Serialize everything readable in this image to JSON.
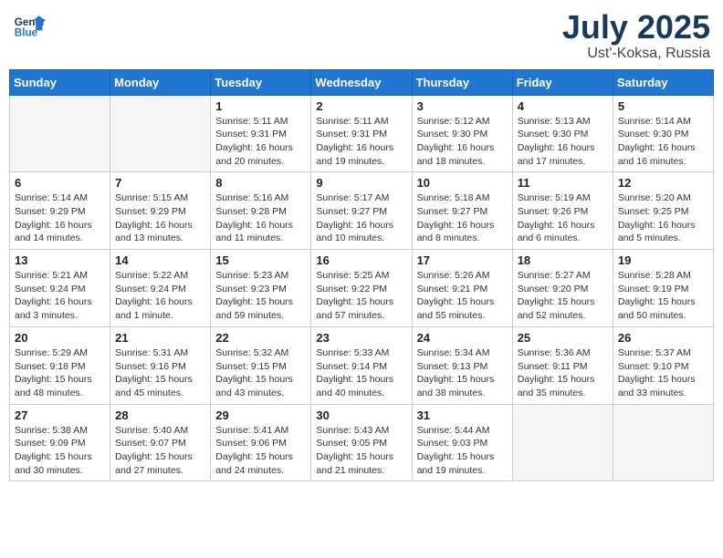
{
  "header": {
    "logo_line1": "General",
    "logo_line2": "Blue",
    "title": "July 2025",
    "subtitle": "Ust'-Koksa, Russia"
  },
  "weekdays": [
    "Sunday",
    "Monday",
    "Tuesday",
    "Wednesday",
    "Thursday",
    "Friday",
    "Saturday"
  ],
  "weeks": [
    [
      {
        "day": "",
        "info": ""
      },
      {
        "day": "",
        "info": ""
      },
      {
        "day": "1",
        "info": "Sunrise: 5:11 AM\nSunset: 9:31 PM\nDaylight: 16 hours\nand 20 minutes."
      },
      {
        "day": "2",
        "info": "Sunrise: 5:11 AM\nSunset: 9:31 PM\nDaylight: 16 hours\nand 19 minutes."
      },
      {
        "day": "3",
        "info": "Sunrise: 5:12 AM\nSunset: 9:30 PM\nDaylight: 16 hours\nand 18 minutes."
      },
      {
        "day": "4",
        "info": "Sunrise: 5:13 AM\nSunset: 9:30 PM\nDaylight: 16 hours\nand 17 minutes."
      },
      {
        "day": "5",
        "info": "Sunrise: 5:14 AM\nSunset: 9:30 PM\nDaylight: 16 hours\nand 16 minutes."
      }
    ],
    [
      {
        "day": "6",
        "info": "Sunrise: 5:14 AM\nSunset: 9:29 PM\nDaylight: 16 hours\nand 14 minutes."
      },
      {
        "day": "7",
        "info": "Sunrise: 5:15 AM\nSunset: 9:29 PM\nDaylight: 16 hours\nand 13 minutes."
      },
      {
        "day": "8",
        "info": "Sunrise: 5:16 AM\nSunset: 9:28 PM\nDaylight: 16 hours\nand 11 minutes."
      },
      {
        "day": "9",
        "info": "Sunrise: 5:17 AM\nSunset: 9:27 PM\nDaylight: 16 hours\nand 10 minutes."
      },
      {
        "day": "10",
        "info": "Sunrise: 5:18 AM\nSunset: 9:27 PM\nDaylight: 16 hours\nand 8 minutes."
      },
      {
        "day": "11",
        "info": "Sunrise: 5:19 AM\nSunset: 9:26 PM\nDaylight: 16 hours\nand 6 minutes."
      },
      {
        "day": "12",
        "info": "Sunrise: 5:20 AM\nSunset: 9:25 PM\nDaylight: 16 hours\nand 5 minutes."
      }
    ],
    [
      {
        "day": "13",
        "info": "Sunrise: 5:21 AM\nSunset: 9:24 PM\nDaylight: 16 hours\nand 3 minutes."
      },
      {
        "day": "14",
        "info": "Sunrise: 5:22 AM\nSunset: 9:24 PM\nDaylight: 16 hours\nand 1 minute."
      },
      {
        "day": "15",
        "info": "Sunrise: 5:23 AM\nSunset: 9:23 PM\nDaylight: 15 hours\nand 59 minutes."
      },
      {
        "day": "16",
        "info": "Sunrise: 5:25 AM\nSunset: 9:22 PM\nDaylight: 15 hours\nand 57 minutes."
      },
      {
        "day": "17",
        "info": "Sunrise: 5:26 AM\nSunset: 9:21 PM\nDaylight: 15 hours\nand 55 minutes."
      },
      {
        "day": "18",
        "info": "Sunrise: 5:27 AM\nSunset: 9:20 PM\nDaylight: 15 hours\nand 52 minutes."
      },
      {
        "day": "19",
        "info": "Sunrise: 5:28 AM\nSunset: 9:19 PM\nDaylight: 15 hours\nand 50 minutes."
      }
    ],
    [
      {
        "day": "20",
        "info": "Sunrise: 5:29 AM\nSunset: 9:18 PM\nDaylight: 15 hours\nand 48 minutes."
      },
      {
        "day": "21",
        "info": "Sunrise: 5:31 AM\nSunset: 9:16 PM\nDaylight: 15 hours\nand 45 minutes."
      },
      {
        "day": "22",
        "info": "Sunrise: 5:32 AM\nSunset: 9:15 PM\nDaylight: 15 hours\nand 43 minutes."
      },
      {
        "day": "23",
        "info": "Sunrise: 5:33 AM\nSunset: 9:14 PM\nDaylight: 15 hours\nand 40 minutes."
      },
      {
        "day": "24",
        "info": "Sunrise: 5:34 AM\nSunset: 9:13 PM\nDaylight: 15 hours\nand 38 minutes."
      },
      {
        "day": "25",
        "info": "Sunrise: 5:36 AM\nSunset: 9:11 PM\nDaylight: 15 hours\nand 35 minutes."
      },
      {
        "day": "26",
        "info": "Sunrise: 5:37 AM\nSunset: 9:10 PM\nDaylight: 15 hours\nand 33 minutes."
      }
    ],
    [
      {
        "day": "27",
        "info": "Sunrise: 5:38 AM\nSunset: 9:09 PM\nDaylight: 15 hours\nand 30 minutes."
      },
      {
        "day": "28",
        "info": "Sunrise: 5:40 AM\nSunset: 9:07 PM\nDaylight: 15 hours\nand 27 minutes."
      },
      {
        "day": "29",
        "info": "Sunrise: 5:41 AM\nSunset: 9:06 PM\nDaylight: 15 hours\nand 24 minutes."
      },
      {
        "day": "30",
        "info": "Sunrise: 5:43 AM\nSunset: 9:05 PM\nDaylight: 15 hours\nand 21 minutes."
      },
      {
        "day": "31",
        "info": "Sunrise: 5:44 AM\nSunset: 9:03 PM\nDaylight: 15 hours\nand 19 minutes."
      },
      {
        "day": "",
        "info": ""
      },
      {
        "day": "",
        "info": ""
      }
    ]
  ]
}
